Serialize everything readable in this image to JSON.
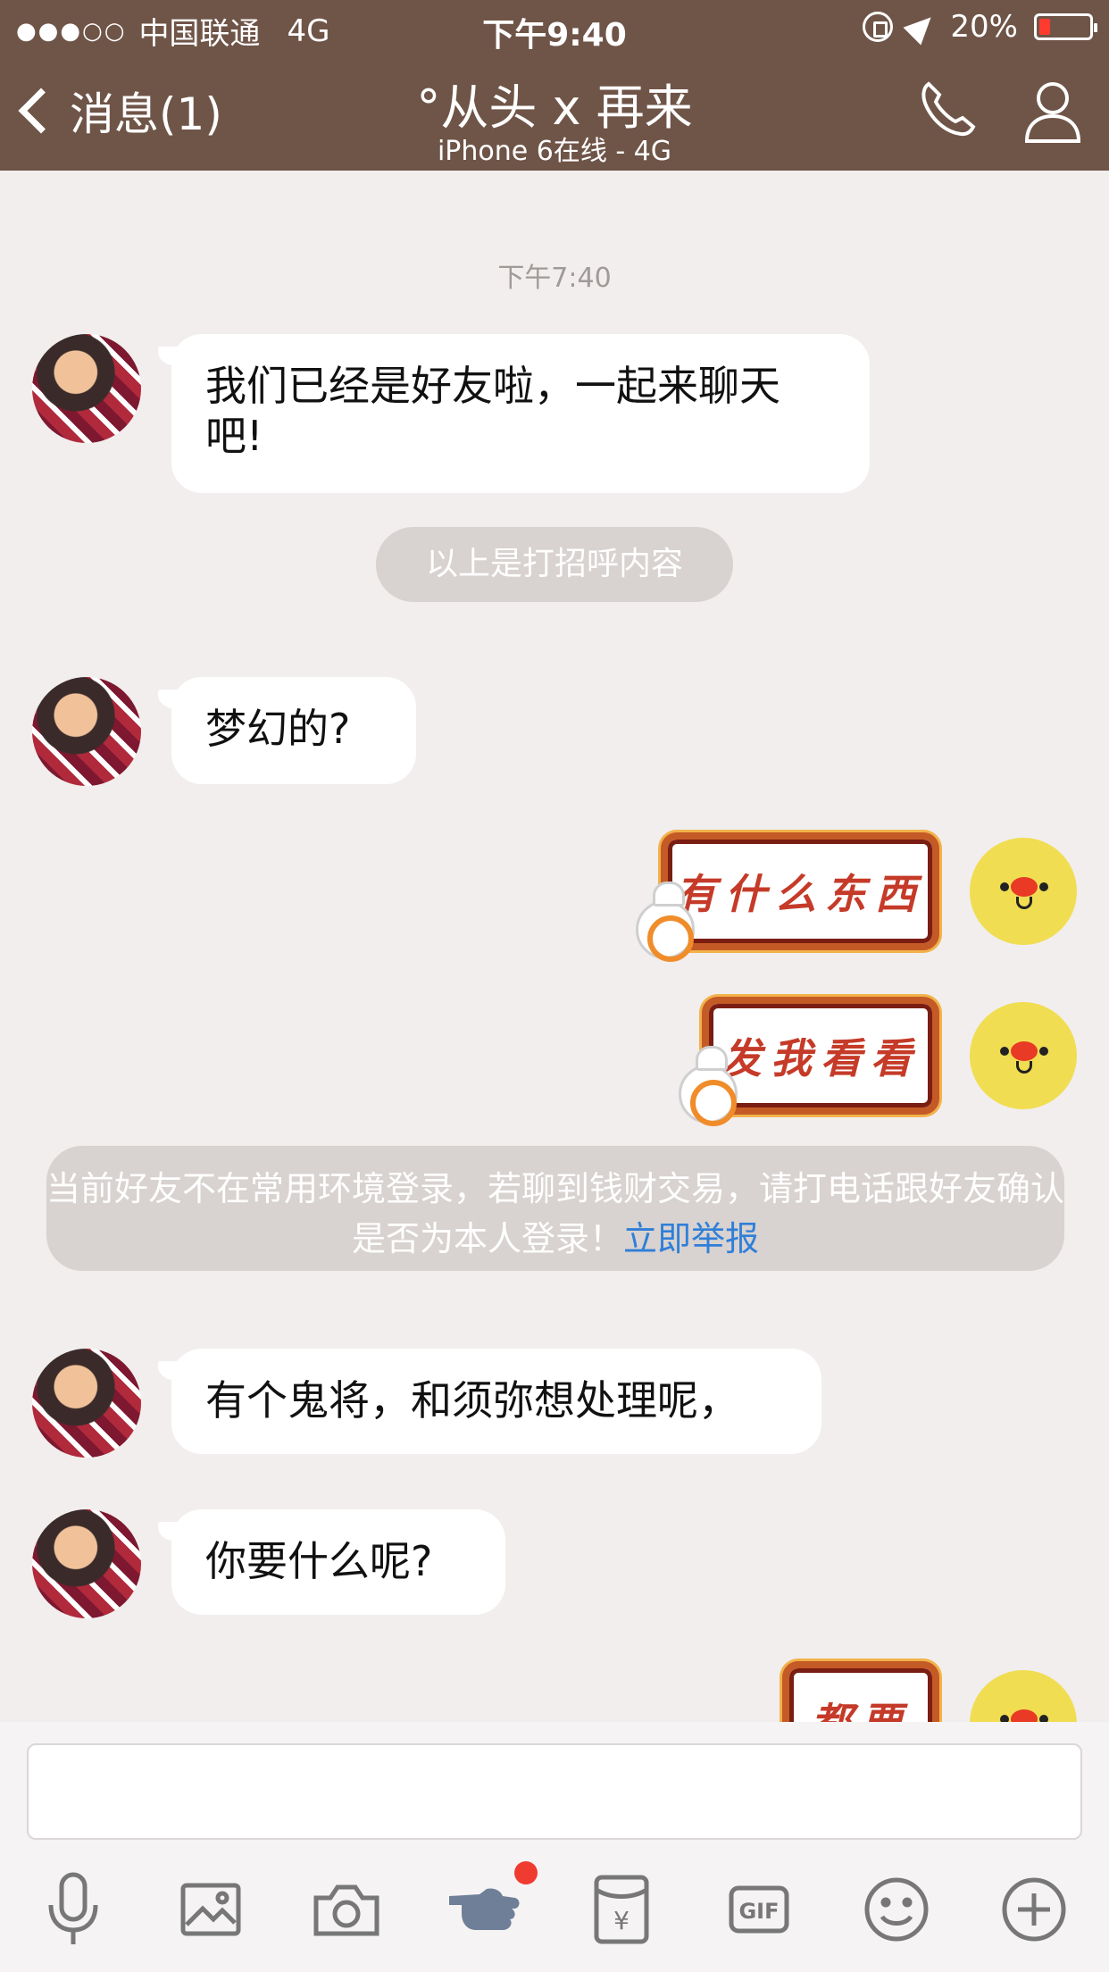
{
  "status_bar": {
    "signal": "●●●○○",
    "carrier": "中国联通",
    "network": "4G",
    "time": "下午9:40",
    "battery": "20%"
  },
  "nav": {
    "back_label": "消息(1)",
    "title": "°从头 x 再来",
    "subtitle": "iPhone 6在线 - 4G"
  },
  "chat": {
    "timestamp": "下午7:40",
    "messages": [
      {
        "from": "friend",
        "text": "我们已经是好友啦，一起来聊天吧!"
      },
      {
        "from": "system",
        "text": "以上是打招呼内容"
      },
      {
        "from": "friend",
        "text": "梦幻的?"
      },
      {
        "from": "me",
        "sticker": "有什么东西"
      },
      {
        "from": "me",
        "sticker": "发我看看"
      },
      {
        "from": "friend",
        "text": "有个鬼将，和须弥想处理呢，"
      },
      {
        "from": "friend",
        "text": "你要什么呢?"
      },
      {
        "from": "me",
        "sticker": "都要"
      }
    ],
    "notice": {
      "text": "当前好友不在常用环境登录，若聊到钱财交易，请打电话跟好友确认是否为本人登录！",
      "link": "立即举报"
    }
  },
  "input": {
    "value": ""
  },
  "colors": {
    "header_bg": "#6f5548",
    "chat_bg": "#f1eeed",
    "link": "#2f7fd8",
    "badge": "#f03b30"
  },
  "toolbar_icons": [
    "mic-icon",
    "image-icon",
    "camera-icon",
    "poke-icon",
    "red-packet-icon",
    "gif-icon",
    "emoji-icon",
    "plus-icon"
  ]
}
